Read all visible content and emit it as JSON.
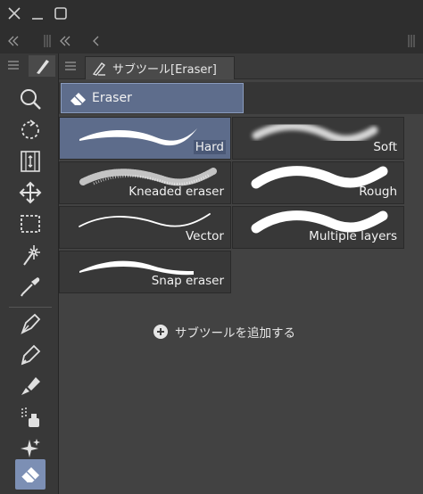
{
  "panel": {
    "subtool_tab": "サブツール[Eraser]",
    "group": "Eraser",
    "add_subtool": "サブツールを追加する"
  },
  "subtools": [
    {
      "label": "Hard",
      "selected": true
    },
    {
      "label": "Soft",
      "selected": false
    },
    {
      "label": "Kneaded eraser",
      "selected": false
    },
    {
      "label": "Rough",
      "selected": false
    },
    {
      "label": "Vector",
      "selected": false
    },
    {
      "label": "Multiple layers",
      "selected": false
    },
    {
      "label": "Snap eraser",
      "selected": false
    }
  ],
  "tools": [
    "zoom-icon",
    "rotate-icon",
    "move-layer-icon",
    "move-icon",
    "selection-icon",
    "auto-select-icon",
    "eyedropper-icon",
    "pen-icon",
    "pencil-icon",
    "brush-icon",
    "airbrush-icon",
    "decoration-icon",
    "eraser-icon"
  ],
  "colors": {
    "accent": "#5d6c8b",
    "panel": "#424242",
    "toolbar": "#383838"
  }
}
